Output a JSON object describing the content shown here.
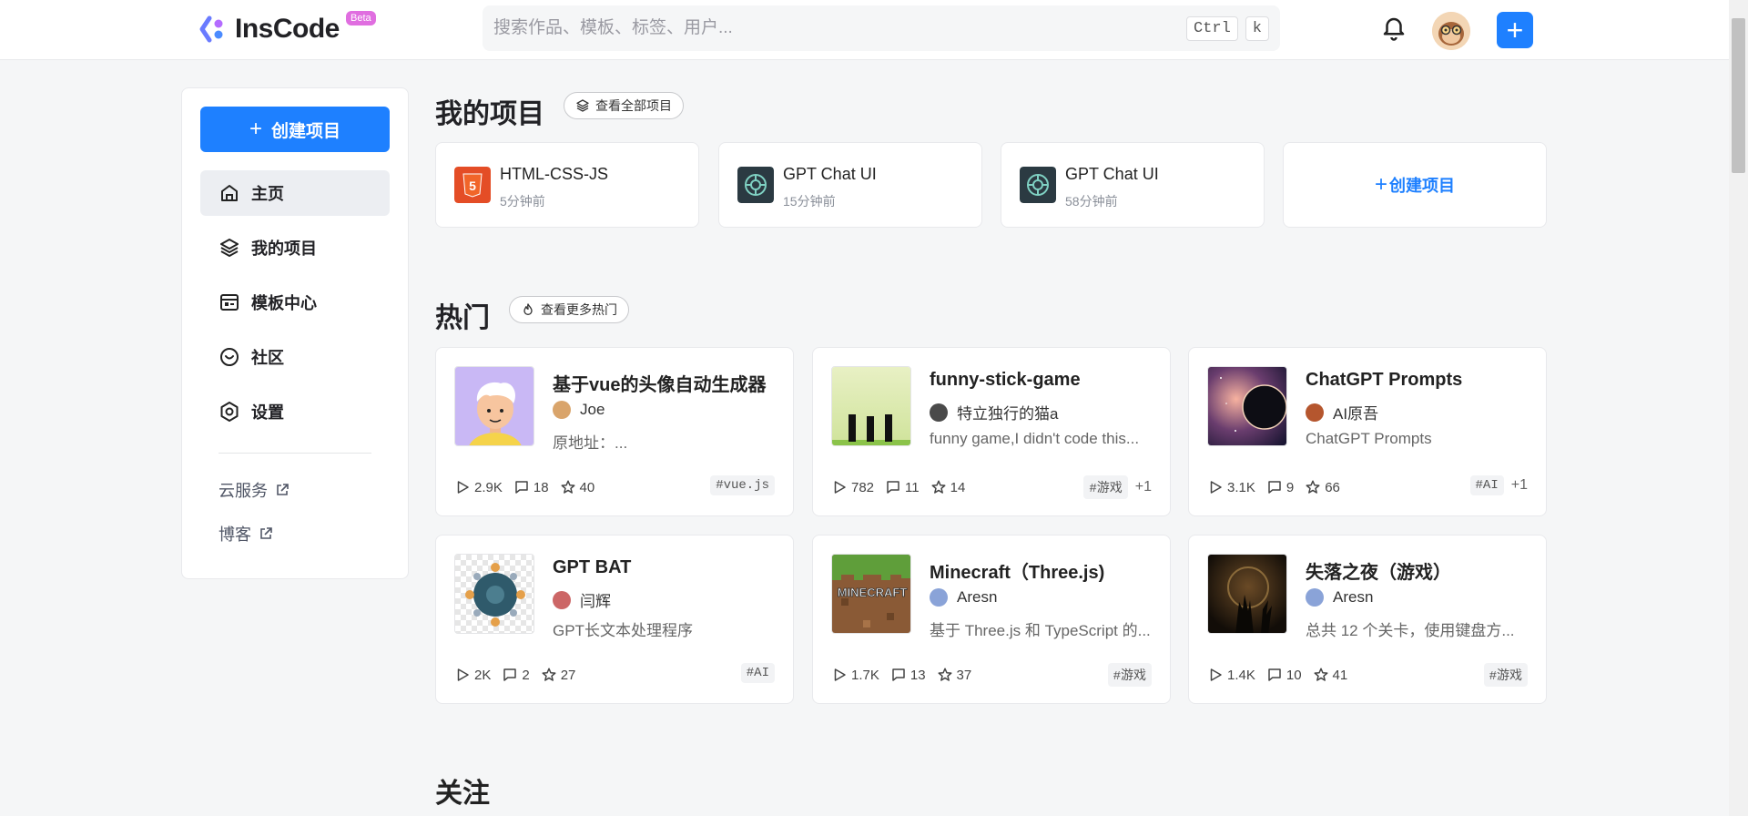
{
  "header": {
    "logo_text": "InsCode",
    "beta": "Beta",
    "search_placeholder": "搜索作品、模板、标签、用户...",
    "kbd_ctrl": "Ctrl",
    "kbd_k": "k",
    "plus": "+"
  },
  "sidebar": {
    "create_label": "创建项目",
    "items": [
      {
        "label": "主页",
        "icon": "home-icon"
      },
      {
        "label": "我的项目",
        "icon": "layers-icon"
      },
      {
        "label": "模板中心",
        "icon": "template-icon"
      },
      {
        "label": "社区",
        "icon": "community-icon"
      },
      {
        "label": "设置",
        "icon": "settings-icon"
      }
    ],
    "links": [
      {
        "label": "云服务"
      },
      {
        "label": "博客"
      }
    ]
  },
  "my_projects": {
    "title": "我的项目",
    "view_all": "查看全部项目",
    "items": [
      {
        "title": "HTML-CSS-JS",
        "time": "5分钟前"
      },
      {
        "title": "GPT Chat UI",
        "time": "15分钟前"
      },
      {
        "title": "GPT Chat UI",
        "time": "58分钟前"
      }
    ],
    "create_label": "创建项目"
  },
  "hot": {
    "title": "热门",
    "view_more": "查看更多热门",
    "items": [
      {
        "title": "基于vue的头像自动生成器",
        "author": "Joe",
        "desc": "原地址：...",
        "views": "2.9K",
        "comments": "18",
        "stars": "40",
        "tag": "#vue.js",
        "more": ""
      },
      {
        "title": "funny-stick-game",
        "author": "特立独行的猫a",
        "desc": "funny game,I didn't code this...",
        "views": "782",
        "comments": "11",
        "stars": "14",
        "tag": "#游戏",
        "more": "+1"
      },
      {
        "title": "ChatGPT Prompts",
        "author": "AI原吾",
        "desc": "ChatGPT Prompts",
        "views": "3.1K",
        "comments": "9",
        "stars": "66",
        "tag": "#AI",
        "more": "+1"
      },
      {
        "title": "GPT BAT",
        "author": "闫辉",
        "desc": "GPT长文本处理程序",
        "views": "2K",
        "comments": "2",
        "stars": "27",
        "tag": "#AI",
        "more": ""
      },
      {
        "title": "Minecraft（Three.js)",
        "author": "Aresn",
        "desc": "基于 Three.js 和 TypeScript 的...",
        "views": "1.7K",
        "comments": "13",
        "stars": "37",
        "tag": "#游戏",
        "more": ""
      },
      {
        "title": "失落之夜（游戏）",
        "author": "Aresn",
        "desc": "总共 12 个关卡，使用键盘方...",
        "views": "1.4K",
        "comments": "10",
        "stars": "41",
        "tag": "#游戏",
        "more": ""
      }
    ]
  },
  "follow": {
    "title": "关注"
  },
  "colors": {
    "accent": "#1e80ff",
    "beta": "#e06ee0"
  }
}
